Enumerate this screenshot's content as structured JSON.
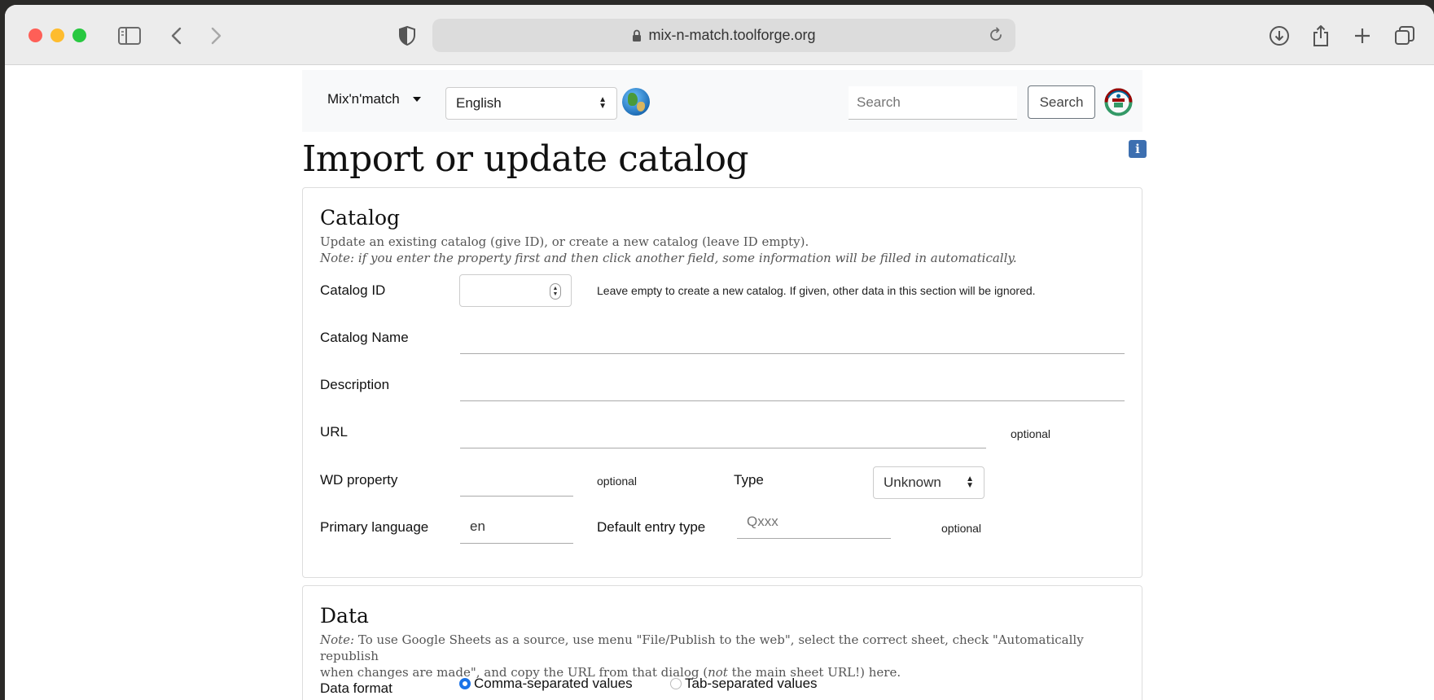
{
  "browser": {
    "url": "mix-n-match.toolforge.org"
  },
  "navbar": {
    "brand": "Mix'n'match",
    "language": "English",
    "search_placeholder": "Search",
    "search_button": "Search"
  },
  "page": {
    "title": "Import or update catalog"
  },
  "catalog_section": {
    "heading": "Catalog",
    "intro": "Update an existing catalog (give ID), or create a new catalog (leave ID empty).",
    "note": "Note: if you enter the property first and then click another field, some information will be filled in automatically.",
    "catalog_id_label": "Catalog ID",
    "catalog_id_help": "Leave empty to create a new catalog. If given, other data in this section will be ignored.",
    "catalog_name_label": "Catalog Name",
    "description_label": "Description",
    "url_label": "URL",
    "url_optional": "optional",
    "wd_property_label": "WD property",
    "wd_property_optional": "optional",
    "type_label": "Type",
    "type_value": "Unknown",
    "primary_language_label": "Primary language",
    "primary_language_value": "en",
    "default_entry_type_label": "Default entry type",
    "default_entry_type_placeholder": "Qxxx",
    "default_entry_type_optional": "optional"
  },
  "data_section": {
    "heading": "Data",
    "note_prefix": "Note:",
    "note_line1": " To use Google Sheets as a source, use menu \"File/Publish to the web\", select the correct sheet, check \"Automatically republish",
    "note_line2a": "when changes are made\", and copy the URL from that dialog (",
    "note_not": "not",
    "note_line2b": " the main sheet URL!) here.",
    "data_format_label": "Data format",
    "format_csv": "Comma-separated values",
    "format_tsv": "Tab-separated values",
    "selected_format": "Comma-separated values"
  },
  "colors": {
    "accent": "#1a73e8",
    "navbar_bg": "#f8f9fa",
    "info_icon": "#3d6fb0"
  }
}
